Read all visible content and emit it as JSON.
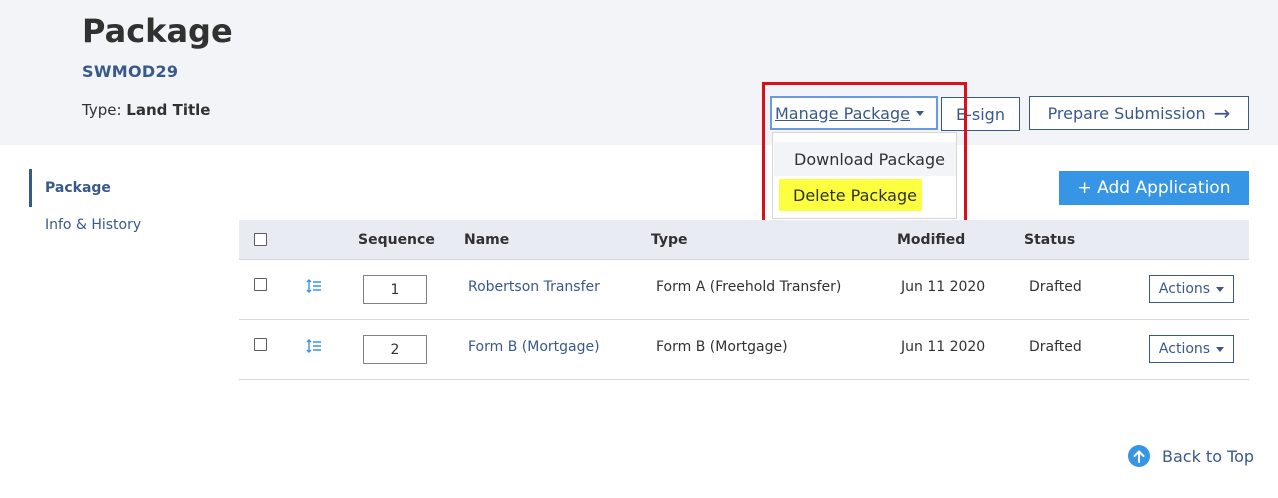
{
  "header": {
    "title": "Package",
    "code": "SWMOD29",
    "type_label": "Type:",
    "type_value": "Land Title"
  },
  "toolbar": {
    "manage_label": "Manage Package",
    "esign_label": "E-sign",
    "prepare_label": "Prepare Submission",
    "prepare_icon": "→"
  },
  "manage_menu": {
    "items": [
      "Download Package",
      "Delete Package"
    ]
  },
  "sidebar": {
    "items": [
      {
        "label": "Package",
        "active": true
      },
      {
        "label": "Info & History",
        "active": false
      }
    ]
  },
  "add_application_label": "+ Add Application",
  "table": {
    "columns": [
      "Sequence",
      "Name",
      "Type",
      "Modified",
      "Status"
    ],
    "rows": [
      {
        "sequence": "1",
        "name": "Robertson Transfer",
        "type": "Form A (Freehold Transfer)",
        "modified": "Jun 11 2020",
        "status": "Drafted",
        "actions": "Actions"
      },
      {
        "sequence": "2",
        "name": "Form B (Mortgage)",
        "type": "Form B (Mortgage)",
        "modified": "Jun 11 2020",
        "status": "Drafted",
        "actions": "Actions"
      }
    ]
  },
  "back_to_top": "Back to Top",
  "colors": {
    "brand_blue": "#38598a",
    "accent_blue": "#3795e5",
    "highlight_yellow": "#fbff3f",
    "annotation_red": "#d8101a"
  }
}
